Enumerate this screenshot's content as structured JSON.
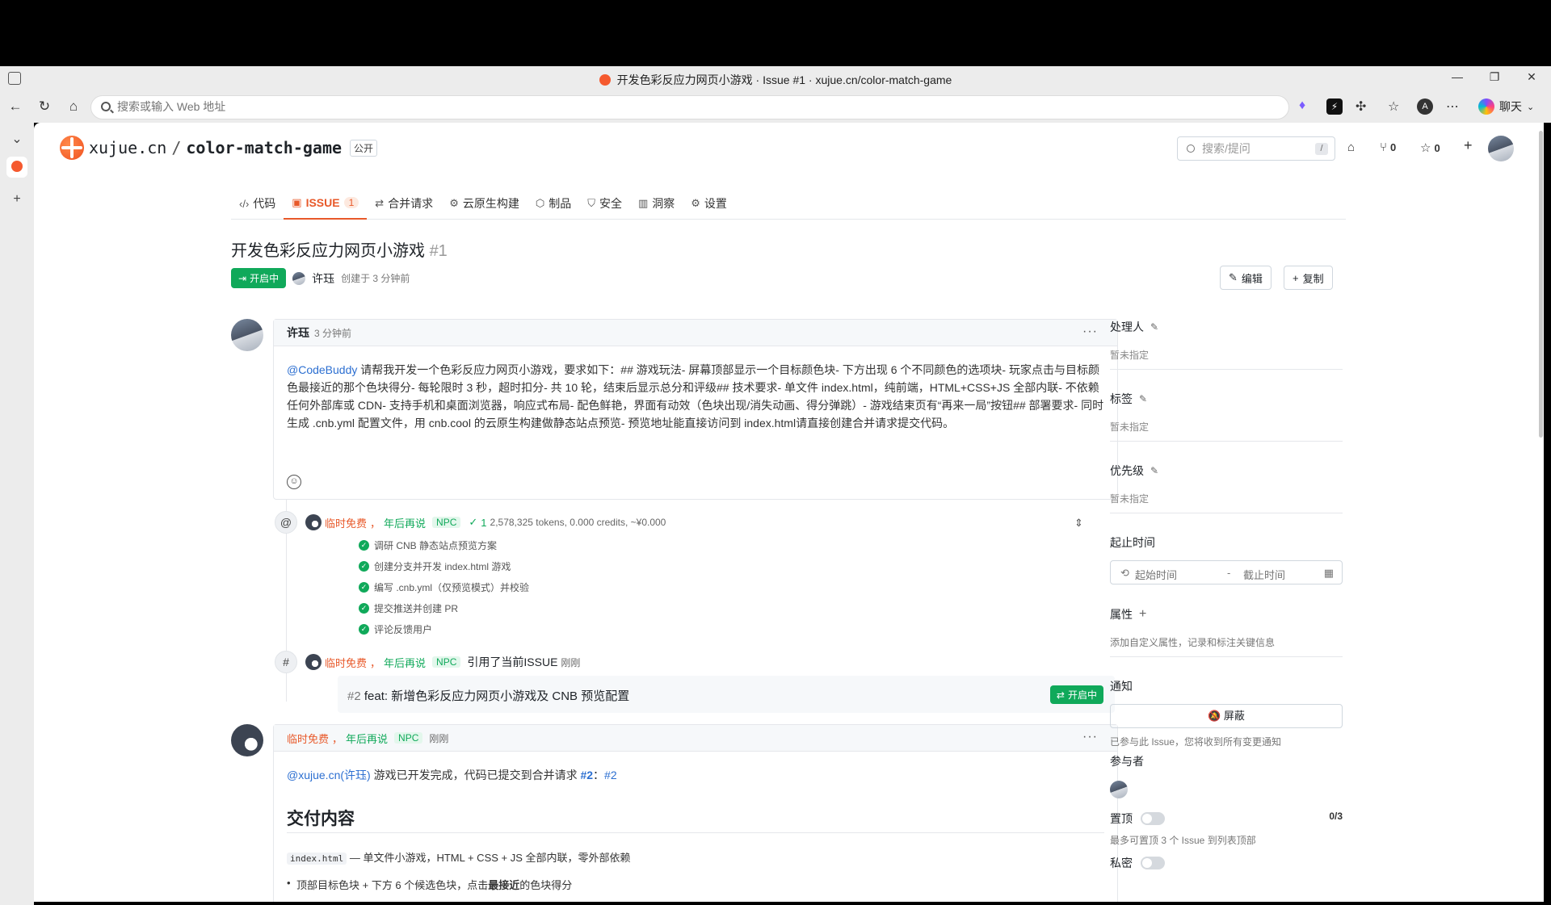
{
  "browser": {
    "window_title": "开发色彩反应力网页小游戏 · Issue #1 · xujue.cn/color-match-game",
    "address_placeholder": "搜索或输入 Web 地址",
    "chat_label": "聊天"
  },
  "header": {
    "org": "xujue.cn",
    "separator": "/",
    "repo": "color-match-game",
    "visibility": "公开",
    "search_placeholder": "搜索/提问",
    "search_shortcut": "/",
    "forks": "0",
    "stars": "0"
  },
  "tabs": [
    {
      "label": "代码"
    },
    {
      "label": "ISSUE",
      "count": "1"
    },
    {
      "label": "合并请求"
    },
    {
      "label": "云原生构建"
    },
    {
      "label": "制品"
    },
    {
      "label": "安全"
    },
    {
      "label": "洞察"
    },
    {
      "label": "设置"
    }
  ],
  "issue": {
    "title": "开发色彩反应力网页小游戏",
    "number": "#1",
    "state": "开启中",
    "author": "许珏",
    "created": "创建于 3 分钟前",
    "edit_label": "编辑",
    "copy_label": "复制"
  },
  "comment1": {
    "author": "许珏",
    "time": "3 分钟前",
    "mention": "@CodeBuddy",
    "body": " 请帮我开发一个色彩反应力网页小游戏，要求如下：## 游戏玩法- 屏幕顶部显示一个目标颜色块- 下方出现 6 个不同颜色的选项块- 玩家点击与目标颜色最接近的那个色块得分- 每轮限时 3 秒，超时扣分- 共 10 轮，结束后显示总分和评级## 技术要求- 单文件 index.html，纯前端，HTML+CSS+JS 全部内联- 不依赖任何外部库或 CDN- 支持手机和桌面浏览器，响应式布局- 配色鲜艳，界面有动效（色块出现/消失动画、得分弹跳）- 游戏结束页有“再来一局”按钮## 部署要求- 同时生成 .cnb.yml 配置文件，用 cnb.cool 的云原生构建做静态站点预览- 预览地址能直接访问到 index.html请直接创建合并请求提交代码。"
  },
  "bot": {
    "name_a": "临时免费",
    "name_sep": "，",
    "name_b": "年后再说",
    "npc": "NPC"
  },
  "event1": {
    "check_count": "1",
    "tokens": "2,578,325 tokens, 0.000 credits, ~¥0.000",
    "tasks": [
      "调研 CNB 静态站点预览方案",
      "创建分支并开发 index.html 游戏",
      "编写 .cnb.yml（仅预览模式）并校验",
      "提交推送并创建 PR",
      "评论反馈用户"
    ]
  },
  "event2": {
    "action": "引用了当前ISSUE",
    "time": "刚刚",
    "pr_number": "#2",
    "pr_title": "feat: 新增色彩反应力网页小游戏及 CNB 预览配置",
    "pr_state": "开启中"
  },
  "comment2": {
    "time": "刚刚",
    "mention": "@xujue.cn(许珏)",
    "text": " 游戏已开发完成，代码已提交到合并请求 ",
    "ref1": "#2",
    "ref_sep": "：",
    "ref2": "#2",
    "heading": "交付内容",
    "deliv_code": "index.html",
    "deliv_text": " — 单文件小游戏，HTML + CSS + JS 全部内联，零外部依赖",
    "bullet_a": "顶部目标色块 + 下方 6 个候选色块，点击",
    "bullet_bold": "最接近",
    "bullet_b": "的色块得分"
  },
  "sidebar": {
    "assignee_label": "处理人",
    "assignee_value": "暂未指定",
    "labels_label": "标签",
    "labels_value": "暂未指定",
    "priority_label": "优先级",
    "priority_value": "暂未指定",
    "deadline_label": "起止时间",
    "start_placeholder": "起始时间",
    "range_sep": "-",
    "end_placeholder": "截止时间",
    "attr_label": "属性",
    "attr_hint": "添加自定义属性，记录和标注关键信息",
    "notify_label": "通知",
    "mute_label": "屏蔽",
    "notify_hint": "已参与此 Issue，您将收到所有变更通知",
    "participants_label": "参与者",
    "pin_label": "置顶",
    "pin_count": "0/3",
    "pin_hint": "最多可置顶 3 个 Issue 到列表顶部",
    "private_label": "私密"
  },
  "colors": {
    "accent": "#e8592a",
    "open_green": "#10a95a",
    "link_blue": "#2c6fd1"
  }
}
